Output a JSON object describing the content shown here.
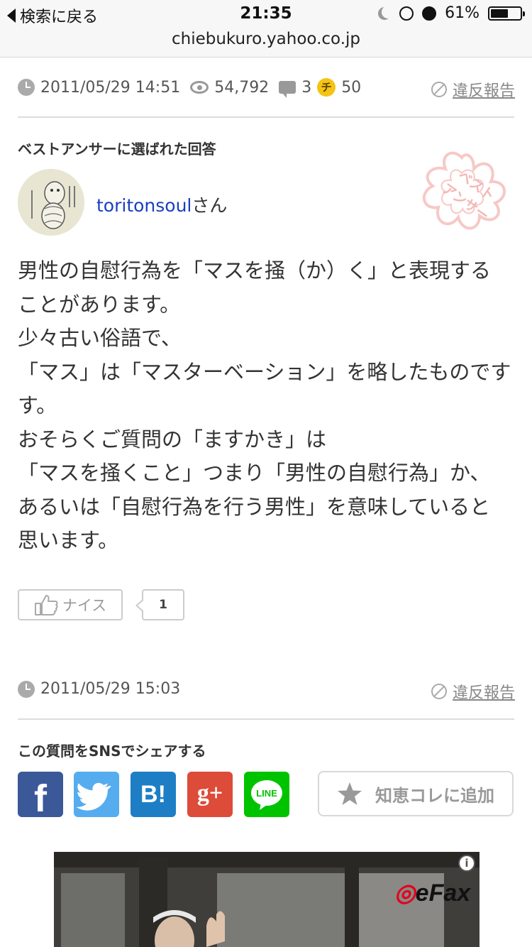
{
  "status_bar": {
    "back_label": "検索に戻る",
    "time": "21:35",
    "battery": "61%",
    "battery_level": 0.61,
    "url": "chiebukuro.yahoo.co.jp"
  },
  "question_meta": {
    "datetime": "2011/05/29 14:51",
    "views": "54,792",
    "answers": "3",
    "coin_icon": "チ",
    "coins": "50",
    "report_label": "違反報告"
  },
  "best_answer": {
    "heading": "ベストアンサーに選ばれた回答",
    "username": "toritonsoul",
    "user_suffix": "さん",
    "stamp_text": [
      "ベスト",
      "アンサー"
    ],
    "body_lines": [
      "男性の自慰行為を「マスを掻（か）く」と表現する",
      "ことがあります。",
      "少々古い俗語で、",
      "「マス」は「マスターベーション」を略したものです",
      "す。",
      "おそらくご質問の「ますかき」は",
      "「マスを掻くこと」つまり「男性の自慰行為」か、",
      "あるいは「自慰行為を行う男性」を意味していると",
      "思います。"
    ],
    "nice_label": "ナイス",
    "nice_count": "1",
    "answer_datetime": "2011/05/29 15:03",
    "report_label": "違反報告"
  },
  "share": {
    "heading": "この質問をSNSでシェアする",
    "services": [
      "facebook",
      "twitter",
      "hatena-bookmark",
      "google-plus",
      "line"
    ],
    "hatena_label": "B!",
    "gplus_label": "g+",
    "line_label": "LINE",
    "chiekore_label": "知恵コレに追加"
  },
  "ad": {
    "brand": "eFax",
    "info_icon": "i"
  },
  "colors": {
    "link": "#1a3fbf",
    "facebook": "#3b5998",
    "twitter": "#55acee",
    "hatena": "#1d7ec6",
    "gplus": "#dd4b39",
    "line": "#00c300",
    "coin": "#f4c414"
  }
}
